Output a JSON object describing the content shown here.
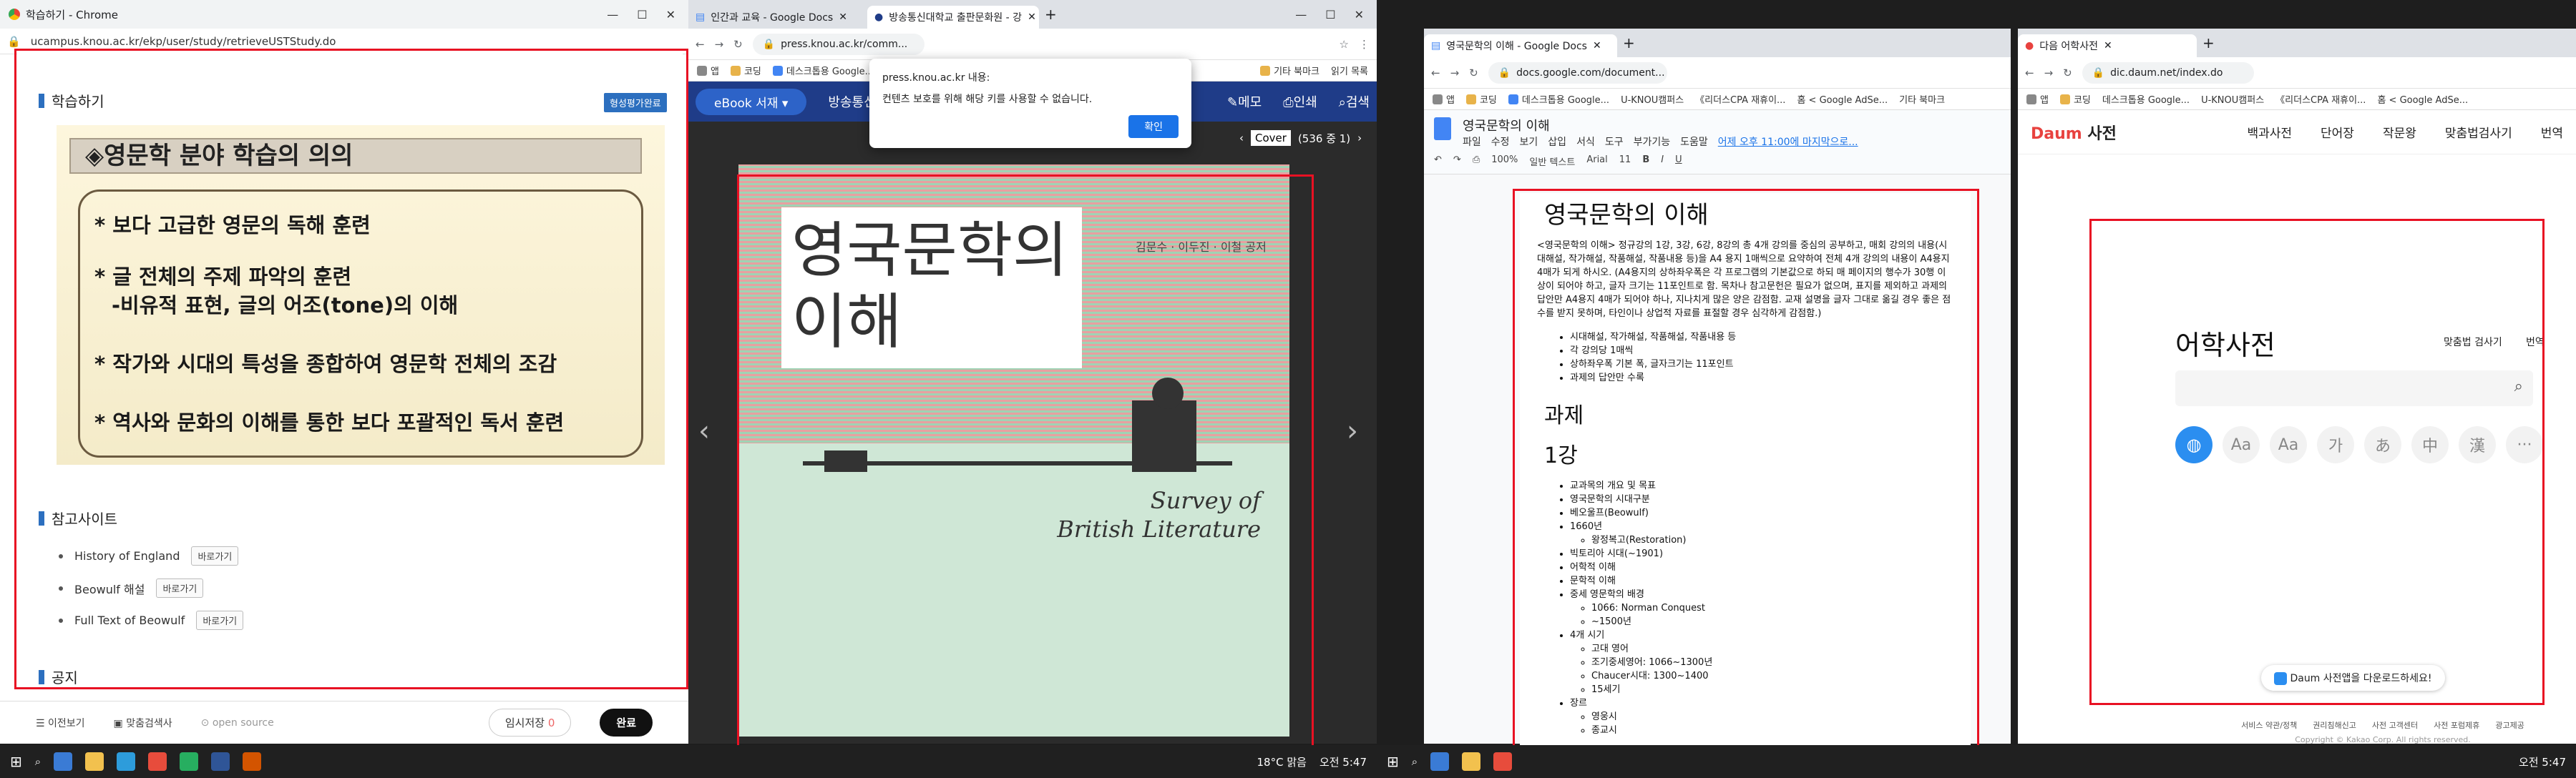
{
  "window1": {
    "title": "학습하기 - Chrome",
    "url": "ucampus.knou.ac.kr/ekp/user/study/retrieveUSTStudy.do",
    "section_study": "학습하기",
    "badge": "형성평가완료",
    "slide": {
      "title": "◈영문학 분야 학습의 의의",
      "items": [
        "* 보다 고급한 영문의 독해 훈련",
        "* 글 전체의 주제 파악의 훈련",
        "-비유적 표현, 글의 어조(tone)의 이해",
        "* 작가와 시대의 특성을 종합하여 영문학 전체의 조감",
        "* 역사와 문화의 이해를 통한 보다 포괄적인 독서 훈련"
      ]
    },
    "section_ref": "참고사이트",
    "refs": [
      {
        "label": "History of England",
        "btn": "바로가기"
      },
      {
        "label": "Beowulf 해설",
        "btn": "바로가기"
      },
      {
        "label": "Full Text of Beowulf",
        "btn": "바로가기"
      }
    ],
    "section_notice": "공지",
    "bottom": {
      "prev": "이전보기",
      "glossary": "맞춤검색사",
      "open_source": "open source",
      "save": "임시저장",
      "save_count": "0",
      "done": "완료"
    }
  },
  "window2": {
    "tabs": [
      "인간과 교육 - Google Docs",
      "방송통신대학교 출판문화원 - 강"
    ],
    "url": "press.knou.ac.kr/comm...",
    "bookmarks": [
      "앱",
      "코딩",
      "데스크톱용 Google...",
      "기타 북마크",
      "읽기 목록"
    ],
    "nav": {
      "ebook": "eBook 서재",
      "site": "방송통신대",
      "note": "메모",
      "print": "인쇄",
      "search": "검색"
    },
    "dialog": {
      "host": "press.knou.ac.kr 내용:",
      "message": "컨텐츠 보호를 위해 해당 키를 사용할 수 없습니다.",
      "ok": "확인"
    },
    "reader": {
      "page_label": "Cover",
      "page_info": "(536 중 1)"
    },
    "book": {
      "title_line1": "영국문학의",
      "title_line2": "이해",
      "authors": "김문수 · 이두진 · 이철 공저",
      "en_title_line1": "Survey of",
      "en_title_line2": "British Literature"
    }
  },
  "window3": {
    "tab": "영국문학의 이해 - Google Docs",
    "url": "docs.google.com/document...",
    "bookmarks": [
      "앱",
      "코딩",
      "데스크톱용 Google...",
      "U-KNOU캠퍼스",
      "《리더스CPA 재휴이...",
      "홈 < Google AdSe...",
      "기타 북마크"
    ],
    "doc_title": "영국문학의 이해",
    "menu": [
      "파일",
      "수정",
      "보기",
      "삽입",
      "서식",
      "도구",
      "부가기능",
      "도움말"
    ],
    "last_edit": "어제 오후 11:00에 마지막으로...",
    "toolbar": {
      "zoom": "100%",
      "style": "일반 텍스트",
      "font": "Arial",
      "size": "11"
    },
    "heading": "영국문학의 이해",
    "intro": "<영국문학의 이해> 정규강의 1강, 3강, 6강, 8강의 총 4개 강의를 중심의 공부하고, 매회 강의의 내용(시대해설, 작가해설, 작품해설, 작품내용 등)을 A4 용지 1매씩으로 요약하여 전체 4개 강의의 내용이 A4용지 4매가 되게 하시오. (A4용지의 상하좌우폭은 각 프로그램의 기본값으로 하되 매 페이지의 행수가 30행 이상이 되어야 하고, 글자 크기는 11포인트로 함. 목차나 참고문헌은 필요가 없으며, 표지를 제외하고 과제의 답안만 A4용지 4매가 되어야 하나, 지나치게 많은 양은 감점함. 교재 설명을 글자 그대로 옮길 경우 좋은 점수를 받지 못하며, 타인이나 상업적 자료를 표절할 경우 심각하게 감점함.)",
    "req": [
      "시대해설, 작가해설, 작품해설, 작품내용 등",
      "각 강의당 1매씩",
      "상하좌우폭 기본 폭, 글자크기는 11포인트",
      "과제의 답안만 수록"
    ],
    "h_task": "과제",
    "h_lecture1": "1강",
    "lecture1": [
      {
        "t": "교과목의 개요 및 목표"
      },
      {
        "t": "영국문학의 시대구분"
      },
      {
        "t": "베오울프(Beowulf)"
      },
      {
        "t": "1660년",
        "sub": [
          "왕정복고(Restoration)"
        ]
      },
      {
        "t": "빅토리아 시대(~1901)"
      },
      {
        "t": "어학적 이해"
      },
      {
        "t": "문학적 이해"
      },
      {
        "t": "중세 영문학의 배경",
        "sub": [
          "1066: Norman Conquest",
          "~1500년"
        ]
      },
      {
        "t": "4개 시기",
        "sub": [
          "고대 영어",
          "조기중세영어: 1066~1300년",
          "Chaucer시대: 1300~1400",
          "15세기"
        ]
      },
      {
        "t": "장르",
        "sub": [
          "영웅시",
          "종교시"
        ]
      }
    ]
  },
  "window4": {
    "tab": "다음 어학사전",
    "url": "dic.daum.net/index.do",
    "logo": "Daum",
    "logo_suffix": "사전",
    "nav": [
      "백과사전",
      "단어장",
      "작문왕",
      "맞춤법검사기",
      "번역"
    ],
    "main_title": "어학사전",
    "spell_link": "맞춤법 검사기",
    "translate_link": "번역",
    "lang_buttons": [
      "Aa",
      "Aa",
      "가",
      "あ",
      "中",
      "漢",
      "···"
    ],
    "download_banner": "Daum 사전앱을 다운로드하세요!",
    "footer_links": [
      "서비스 약관/정책",
      "권리침해신고",
      "사전 고객센터",
      "사전 포럼제휴",
      "광고제공"
    ],
    "copyright": "Copyright © Kakao Corp. All rights reserved."
  },
  "taskbar": {
    "weather": "18°C 맑음",
    "time": "오전 5:47",
    "time2": "오전 5:47"
  }
}
